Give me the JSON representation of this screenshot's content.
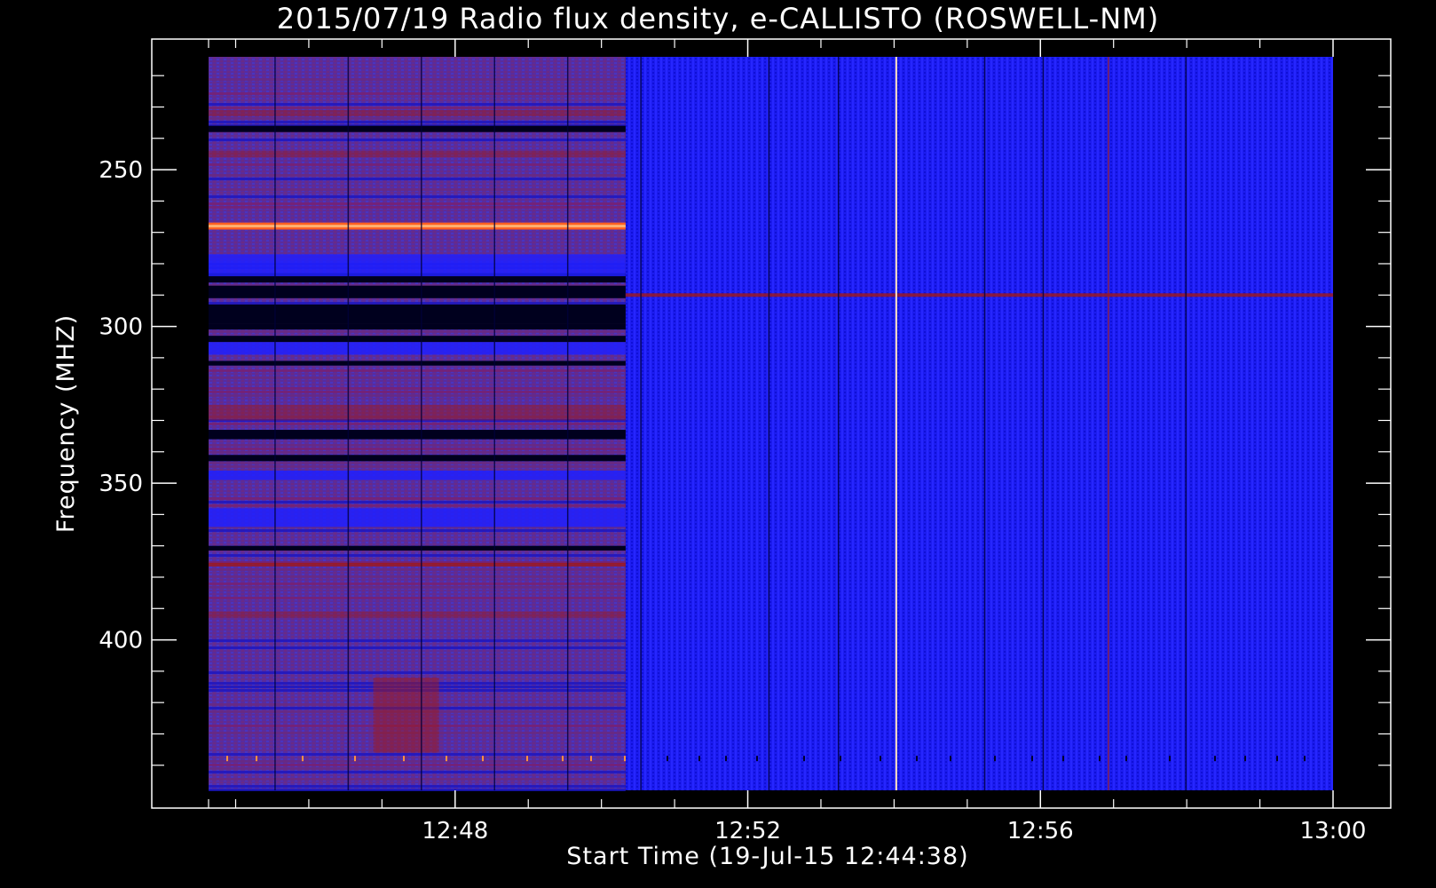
{
  "chart_data": {
    "type": "heatmap",
    "title": "2015/07/19  Radio flux density, e-CALLISTO (ROSWELL-NM)",
    "xlabel": "Start Time (19-Jul-15 12:44:38)",
    "ylabel": "Frequency (MHZ)",
    "x_range_minutes": [
      0,
      15.37
    ],
    "x_ticks": [
      {
        "label": "12:48",
        "minute": 3.37
      },
      {
        "label": "12:52",
        "minute": 7.37
      },
      {
        "label": "12:56",
        "minute": 11.37
      },
      {
        "label": "13:00",
        "minute": 15.37
      }
    ],
    "y_range_mhz": [
      214,
      448
    ],
    "y_inverted": true,
    "y_ticks": [
      250,
      300,
      350,
      400
    ],
    "colormap": [
      "#00001e",
      "#1414c8",
      "#2020ff",
      "#5828a8",
      "#6a2a80",
      "#a01818",
      "#ff6020",
      "#ffb070"
    ],
    "instrument_change_minute": 5.7,
    "features": [
      {
        "kind": "persistent_band",
        "mhz": 268,
        "start_min": 0,
        "end_min": 5.7,
        "level": "high"
      },
      {
        "kind": "persistent_band",
        "mhz": 290,
        "start_min": 5.7,
        "end_min": 15.37,
        "level": "medium"
      },
      {
        "kind": "persistent_band",
        "mhz": 376,
        "start_min": 0,
        "end_min": 5.7,
        "level": "medium"
      },
      {
        "kind": "vertical_spike",
        "minute": 9.4,
        "level": "high"
      },
      {
        "kind": "vertical_spike",
        "minute": 12.3,
        "level": "medium"
      }
    ]
  }
}
